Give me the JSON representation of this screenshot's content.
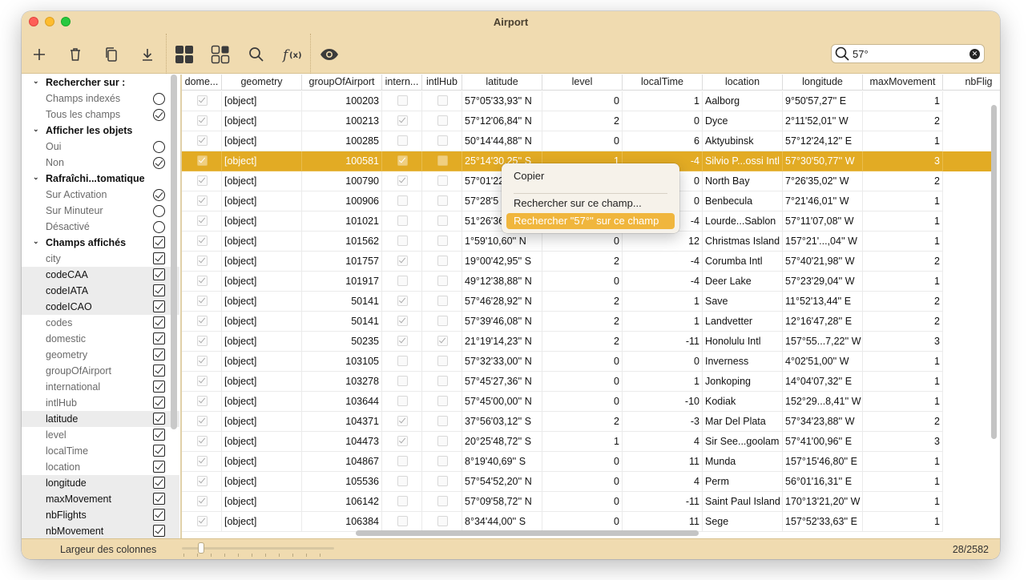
{
  "window": {
    "title": "Airport"
  },
  "search": {
    "value": "57°"
  },
  "sidebar": {
    "rows": [
      {
        "type": "header",
        "label": "Rechercher sur :"
      },
      {
        "type": "radio",
        "label": "Champs indexés",
        "on": false
      },
      {
        "type": "radio",
        "label": "Tous les champs",
        "on": true
      },
      {
        "type": "header",
        "label": "Afficher les objets"
      },
      {
        "type": "radio",
        "label": "Oui",
        "on": false
      },
      {
        "type": "radio",
        "label": "Non",
        "on": true
      },
      {
        "type": "header",
        "label": "Rafraîchi...tomatique"
      },
      {
        "type": "radio",
        "label": "Sur Activation",
        "on": true
      },
      {
        "type": "radio",
        "label": "Sur Minuteur",
        "on": false
      },
      {
        "type": "radio",
        "label": "Désactivé",
        "on": false
      },
      {
        "type": "header-check",
        "label": "Champs affichés"
      },
      {
        "type": "check",
        "label": "city",
        "shaded": false
      },
      {
        "type": "check",
        "label": "codeCAA",
        "shaded": true
      },
      {
        "type": "check",
        "label": "codeIATA",
        "shaded": true
      },
      {
        "type": "check",
        "label": "codeICAO",
        "shaded": true
      },
      {
        "type": "check",
        "label": "codes",
        "shaded": false
      },
      {
        "type": "check",
        "label": "domestic",
        "shaded": false
      },
      {
        "type": "check",
        "label": "geometry",
        "shaded": false
      },
      {
        "type": "check",
        "label": "groupOfAirport",
        "shaded": false
      },
      {
        "type": "check",
        "label": "international",
        "shaded": false
      },
      {
        "type": "check",
        "label": "intlHub",
        "shaded": false
      },
      {
        "type": "check",
        "label": "latitude",
        "shaded": true
      },
      {
        "type": "check",
        "label": "level",
        "shaded": false
      },
      {
        "type": "check",
        "label": "localTime",
        "shaded": false
      },
      {
        "type": "check",
        "label": "location",
        "shaded": false
      },
      {
        "type": "check",
        "label": "longitude",
        "shaded": true
      },
      {
        "type": "check",
        "label": "maxMovement",
        "shaded": true
      },
      {
        "type": "check",
        "label": "nbFlights",
        "shaded": true
      },
      {
        "type": "check",
        "label": "nbMovement",
        "shaded": true
      }
    ]
  },
  "table": {
    "columns": [
      "dome...",
      "geometry",
      "groupOfAirport",
      "intern...",
      "intlHub",
      "latitude",
      "level",
      "localTime",
      "location",
      "longitude",
      "maxMovement",
      "nbFlig"
    ],
    "rows": [
      {
        "dom": true,
        "geo": "[object]",
        "grp": "100203",
        "intl": false,
        "hub": false,
        "lat": "57°05'33,93'' N",
        "lvl": "0",
        "lt": "1",
        "loc": "Aalborg",
        "lon": "9°50'57,27'' E",
        "max": "1"
      },
      {
        "dom": true,
        "geo": "[object]",
        "grp": "100213",
        "intl": true,
        "hub": false,
        "lat": "57°12'06,84'' N",
        "lvl": "2",
        "lt": "0",
        "loc": "Dyce",
        "lon": "2°11'52,01'' W",
        "max": "2"
      },
      {
        "dom": true,
        "geo": "[object]",
        "grp": "100285",
        "intl": false,
        "hub": false,
        "lat": "50°14'44,88'' N",
        "lvl": "0",
        "lt": "6",
        "loc": "Aktyubinsk",
        "lon": "57°12'24,12'' E",
        "max": "1"
      },
      {
        "dom": true,
        "geo": "[object]",
        "grp": "100581",
        "intl": true,
        "hub": false,
        "lat": "25°14'30,25'' S",
        "lvl": "1",
        "lt": "-4",
        "loc": "Silvio P...ossi Intl",
        "lon": "57°30'50,77'' W",
        "max": "3",
        "sel": true
      },
      {
        "dom": true,
        "geo": "[object]",
        "grp": "100790",
        "intl": true,
        "hub": false,
        "lat": "57°01'22",
        "lvl": "",
        "lt": "0",
        "loc": "North Bay",
        "lon": "7°26'35,02'' W",
        "max": "2"
      },
      {
        "dom": true,
        "geo": "[object]",
        "grp": "100906",
        "intl": false,
        "hub": false,
        "lat": "57°28'5",
        "lvl": "",
        "lt": "0",
        "loc": "Benbecula",
        "lon": "7°21'46,01'' W",
        "max": "1"
      },
      {
        "dom": true,
        "geo": "[object]",
        "grp": "101021",
        "intl": false,
        "hub": false,
        "lat": "51°26'36",
        "lvl": "",
        "lt": "-4",
        "loc": "Lourde...Sablon",
        "lon": "57°11'07,08'' W",
        "max": "1"
      },
      {
        "dom": true,
        "geo": "[object]",
        "grp": "101562",
        "intl": false,
        "hub": false,
        "lat": "1°59'10,60'' N",
        "lvl": "0",
        "lt": "12",
        "loc": "Christmas Island",
        "lon": "157°21'...,04'' W",
        "max": "1"
      },
      {
        "dom": true,
        "geo": "[object]",
        "grp": "101757",
        "intl": true,
        "hub": false,
        "lat": "19°00'42,95'' S",
        "lvl": "2",
        "lt": "-4",
        "loc": "Corumba Intl",
        "lon": "57°40'21,98'' W",
        "max": "2"
      },
      {
        "dom": true,
        "geo": "[object]",
        "grp": "101917",
        "intl": false,
        "hub": false,
        "lat": "49°12'38,88'' N",
        "lvl": "0",
        "lt": "-4",
        "loc": "Deer Lake",
        "lon": "57°23'29,04'' W",
        "max": "1"
      },
      {
        "dom": true,
        "geo": "[object]",
        "grp": "50141",
        "intl": true,
        "hub": false,
        "lat": "57°46'28,92'' N",
        "lvl": "2",
        "lt": "1",
        "loc": "Save",
        "lon": "11°52'13,44'' E",
        "max": "2"
      },
      {
        "dom": true,
        "geo": "[object]",
        "grp": "50141",
        "intl": true,
        "hub": false,
        "lat": "57°39'46,08'' N",
        "lvl": "2",
        "lt": "1",
        "loc": "Landvetter",
        "lon": "12°16'47,28'' E",
        "max": "2"
      },
      {
        "dom": true,
        "geo": "[object]",
        "grp": "50235",
        "intl": true,
        "hub": true,
        "lat": "21°19'14,23'' N",
        "lvl": "2",
        "lt": "-11",
        "loc": "Honolulu Intl",
        "lon": "157°55...7,22'' W",
        "max": "3"
      },
      {
        "dom": true,
        "geo": "[object]",
        "grp": "103105",
        "intl": false,
        "hub": false,
        "lat": "57°32'33,00'' N",
        "lvl": "0",
        "lt": "0",
        "loc": "Inverness",
        "lon": "4°02'51,00'' W",
        "max": "1"
      },
      {
        "dom": true,
        "geo": "[object]",
        "grp": "103278",
        "intl": false,
        "hub": false,
        "lat": "57°45'27,36'' N",
        "lvl": "0",
        "lt": "1",
        "loc": "Jonkoping",
        "lon": "14°04'07,32'' E",
        "max": "1"
      },
      {
        "dom": true,
        "geo": "[object]",
        "grp": "103644",
        "intl": false,
        "hub": false,
        "lat": "57°45'00,00'' N",
        "lvl": "0",
        "lt": "-10",
        "loc": "Kodiak",
        "lon": "152°29...8,41'' W",
        "max": "1"
      },
      {
        "dom": true,
        "geo": "[object]",
        "grp": "104371",
        "intl": true,
        "hub": false,
        "lat": "37°56'03,12'' S",
        "lvl": "2",
        "lt": "-3",
        "loc": "Mar Del Plata",
        "lon": "57°34'23,88'' W",
        "max": "2"
      },
      {
        "dom": true,
        "geo": "[object]",
        "grp": "104473",
        "intl": true,
        "hub": false,
        "lat": "20°25'48,72'' S",
        "lvl": "1",
        "lt": "4",
        "loc": "Sir See...goolam",
        "lon": "57°41'00,96'' E",
        "max": "3"
      },
      {
        "dom": true,
        "geo": "[object]",
        "grp": "104867",
        "intl": false,
        "hub": false,
        "lat": "8°19'40,69'' S",
        "lvl": "0",
        "lt": "11",
        "loc": "Munda",
        "lon": "157°15'46,80'' E",
        "max": "1"
      },
      {
        "dom": true,
        "geo": "[object]",
        "grp": "105536",
        "intl": false,
        "hub": false,
        "lat": "57°54'52,20'' N",
        "lvl": "0",
        "lt": "4",
        "loc": "Perm",
        "lon": "56°01'16,31'' E",
        "max": "1"
      },
      {
        "dom": true,
        "geo": "[object]",
        "grp": "106142",
        "intl": false,
        "hub": false,
        "lat": "57°09'58,72'' N",
        "lvl": "0",
        "lt": "-11",
        "loc": "Saint Paul Island",
        "lon": "170°13'21,20'' W",
        "max": "1"
      },
      {
        "dom": true,
        "geo": "[object]",
        "grp": "106384",
        "intl": false,
        "hub": false,
        "lat": "8°34'44,00'' S",
        "lvl": "0",
        "lt": "11",
        "loc": "Sege",
        "lon": "157°52'33,63'' E",
        "max": "1"
      }
    ]
  },
  "context_menu": {
    "items": [
      "Copier",
      "Rechercher sur ce champ...",
      "Rechercher \"57°\" sur ce champ"
    ]
  },
  "footer": {
    "label": "Largeur des colonnes",
    "count": "28/2582"
  }
}
